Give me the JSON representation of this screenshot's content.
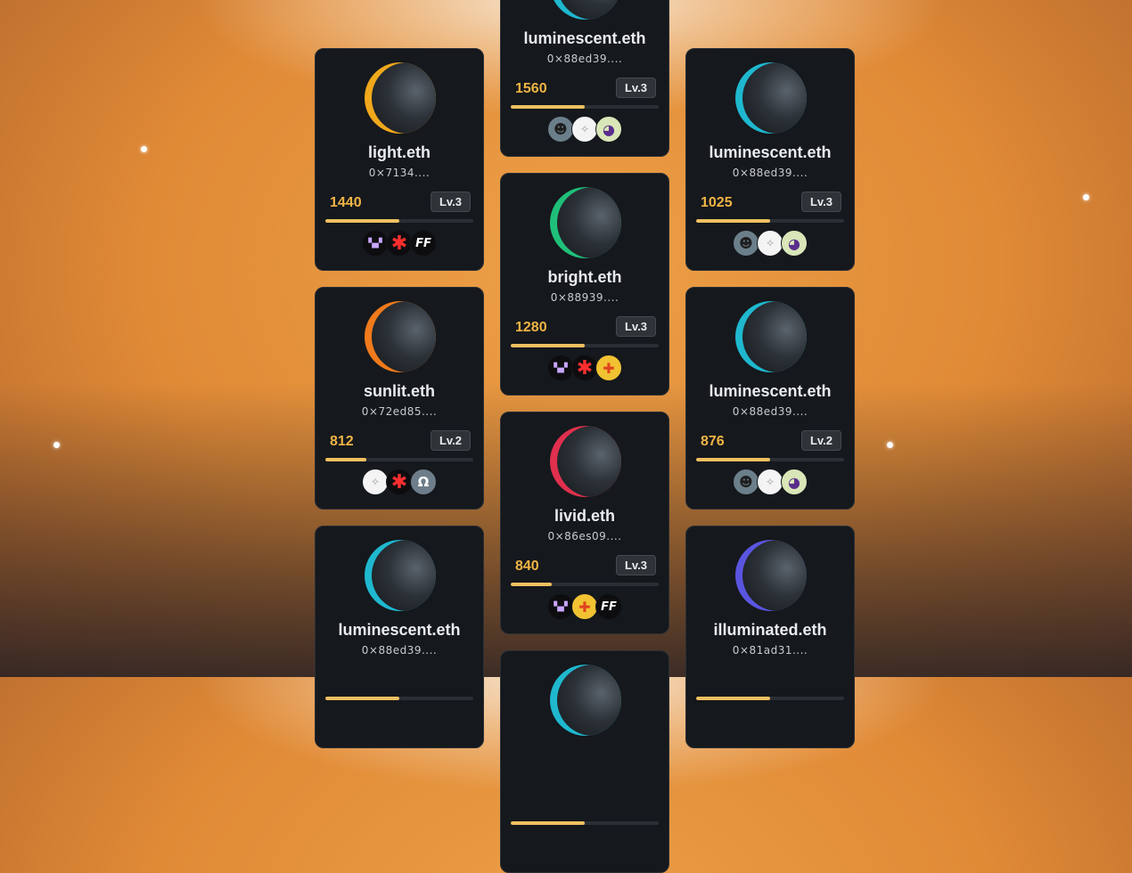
{
  "theme": {
    "accent": "#f0b445",
    "card_bg": "#15181c",
    "progress": "#f0c060"
  },
  "cards": [
    {
      "name": "luminescent.eth",
      "address": "0×88ed39....",
      "score": "1560",
      "level": "Lv.3",
      "progress": 0.5,
      "orb_color": "#1fb8cf",
      "avatars": [
        "punk-avatar",
        "sketch-avatar",
        "panda-avatar"
      ]
    },
    {
      "name": "light.eth",
      "address": "0×7134....",
      "score": "1440",
      "level": "Lv.3",
      "progress": 0.5,
      "orb_color": "#f0a81c",
      "avatars": [
        "pixel-avatar",
        "asterisk-avatar",
        "ff-avatar"
      ]
    },
    {
      "name": "luminescent.eth",
      "address": "0×88ed39....",
      "score": "1025",
      "level": "Lv.3",
      "progress": 0.5,
      "orb_color": "#1fb8cf",
      "avatars": [
        "punk-avatar",
        "sketch-avatar",
        "panda-avatar"
      ]
    },
    {
      "name": "bright.eth",
      "address": "0×88939....",
      "score": "1280",
      "level": "Lv.3",
      "progress": 0.5,
      "orb_color": "#1fbf7a",
      "avatars": [
        "pixel-avatar",
        "asterisk-avatar",
        "gold-avatar"
      ]
    },
    {
      "name": "sunlit.eth",
      "address": "0×72ed85....",
      "score": "812",
      "level": "Lv.2",
      "progress": 0.28,
      "orb_color": "#f07a1c",
      "avatars": [
        "sketch-avatar",
        "asterisk-avatar",
        "omega-avatar"
      ]
    },
    {
      "name": "luminescent.eth",
      "address": "0×88ed39....",
      "score": "876",
      "level": "Lv.2",
      "progress": 0.5,
      "orb_color": "#1fb8cf",
      "avatars": [
        "punk-avatar",
        "sketch-avatar",
        "panda-avatar"
      ]
    },
    {
      "name": "livid.eth",
      "address": "0×86es09....",
      "score": "840",
      "level": "Lv.3",
      "progress": 0.28,
      "orb_color": "#e0304e",
      "avatars": [
        "pixel-avatar",
        "gold-avatar",
        "ff-avatar"
      ]
    },
    {
      "name": "luminescent.eth",
      "address": "0×88ed39....",
      "score": "",
      "level": "",
      "progress": 0.5,
      "orb_color": "#1fb8cf",
      "avatars": []
    },
    {
      "name": "illuminated.eth",
      "address": "0×81ad31....",
      "score": "",
      "level": "",
      "progress": 0.5,
      "orb_color": "#5a55e0",
      "avatars": []
    },
    {
      "name": "",
      "address": "",
      "score": "",
      "level": "",
      "progress": 0.5,
      "orb_color": "#1fb8cf",
      "avatars": []
    }
  ],
  "avatar_glyphs": {
    "punk-avatar": "☻",
    "sketch-avatar": "✧",
    "panda-avatar": "◕",
    "pixel-avatar": "▚▞",
    "asterisk-avatar": "✱",
    "ff-avatar": "FF",
    "gold-avatar": "✚",
    "omega-avatar": "Ω"
  }
}
